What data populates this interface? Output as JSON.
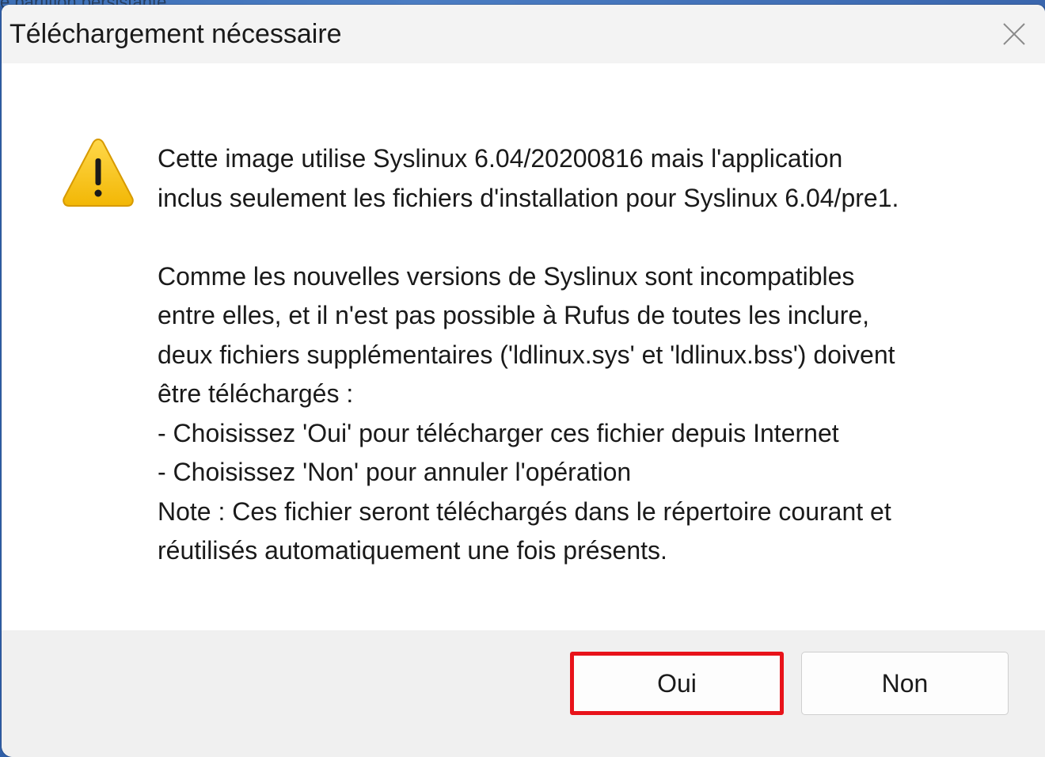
{
  "background": {
    "partial_text": "e partition persistante"
  },
  "dialog": {
    "title": "Téléchargement nécessaire",
    "icons": {
      "warning": "warning-triangle-icon",
      "close": "close-icon"
    },
    "message": {
      "line1": "Cette image utilise Syslinux 6.04/20200816 mais l'application",
      "line2": "inclus seulement les fichiers d'installation pour Syslinux 6.04/pre1.",
      "line3": "Comme les nouvelles versions de Syslinux sont incompatibles",
      "line4": "entre elles, et il n'est pas possible à Rufus de toutes les inclure,",
      "line5": "deux fichiers supplémentaires ('ldlinux.sys' et 'ldlinux.bss') doivent",
      "line6": "être téléchargés :",
      "line7": "- Choisissez 'Oui' pour télécharger ces fichier depuis Internet",
      "line8": "- Choisissez 'Non' pour annuler l'opération",
      "line9": "Note : Ces fichier seront téléchargés dans le répertoire courant et",
      "line10": "réutilisés automatiquement une fois présents."
    },
    "buttons": {
      "yes_label": "Oui",
      "no_label": "Non"
    }
  },
  "colors": {
    "highlight": "#e8131a",
    "warning_fill": "#f7c21b",
    "footer_bg": "#f0f0f0"
  }
}
